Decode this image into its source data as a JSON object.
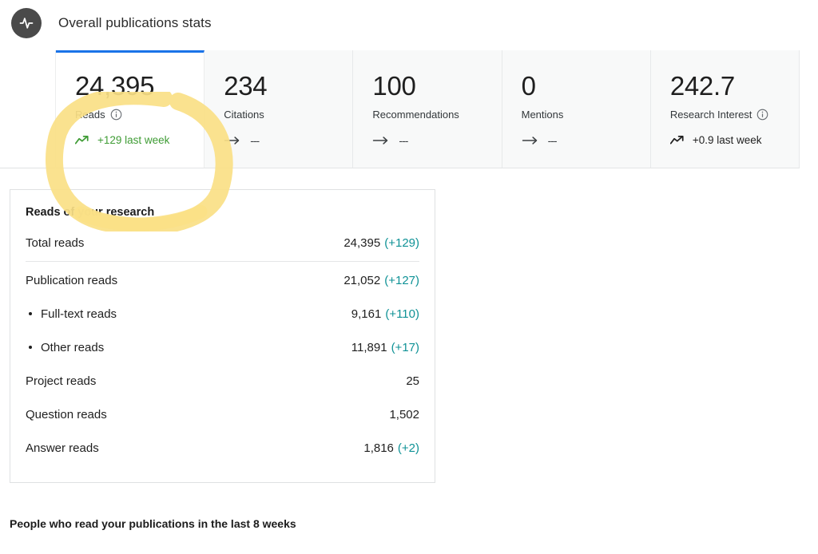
{
  "header": {
    "icon": "activity-pulse-icon",
    "title": "Overall publications stats"
  },
  "stats": {
    "cards": [
      {
        "value": "24,395",
        "label": "Reads",
        "has_info": true,
        "info_icon": "info-circle-icon",
        "trend_icon": "trend-up-icon",
        "trend_text": "+129 last week",
        "trend_state": "up",
        "active": true,
        "highlighted": true
      },
      {
        "value": "234",
        "label": "Citations",
        "has_info": false,
        "trend_icon": "arrow-right-icon",
        "trend_text": "---",
        "trend_state": "flat",
        "active": false,
        "highlighted": false
      },
      {
        "value": "100",
        "label": "Recommendations",
        "has_info": false,
        "trend_icon": "arrow-right-icon",
        "trend_text": "---",
        "trend_state": "flat",
        "active": false,
        "highlighted": false
      },
      {
        "value": "0",
        "label": "Mentions",
        "has_info": false,
        "trend_icon": "arrow-right-icon",
        "trend_text": "---",
        "trend_state": "flat",
        "active": false,
        "highlighted": false
      },
      {
        "value": "242.7",
        "label": "Research Interest",
        "has_info": true,
        "info_icon": "info-circle-icon",
        "trend_icon": "trend-up-icon",
        "trend_text": "+0.9 last week",
        "trend_state": "up-dark",
        "active": false,
        "highlighted": false
      }
    ]
  },
  "reads_card": {
    "title": "Reads of your research",
    "rows": [
      {
        "label": "Total reads",
        "value": "24,395",
        "delta": "(+129)",
        "sub": false,
        "divider_after": true
      },
      {
        "label": "Publication reads",
        "value": "21,052",
        "delta": "(+127)",
        "sub": false,
        "divider_after": false
      },
      {
        "label": "Full-text reads",
        "value": "9,161",
        "delta": "(+110)",
        "sub": true,
        "divider_after": false
      },
      {
        "label": "Other reads",
        "value": "11,891",
        "delta": "(+17)",
        "sub": true,
        "divider_after": false
      },
      {
        "label": "Project reads",
        "value": "25",
        "delta": "",
        "sub": false,
        "divider_after": false
      },
      {
        "label": "Question reads",
        "value": "1,502",
        "delta": "",
        "sub": false,
        "divider_after": false
      },
      {
        "label": "Answer reads",
        "value": "1,816",
        "delta": "(+2)",
        "sub": false,
        "divider_after": false
      }
    ]
  },
  "bottom": {
    "heading": "People who read your publications in the last 8 weeks"
  },
  "colors": {
    "accent_blue": "#1a73e8",
    "trend_green": "#3f9c35",
    "delta_teal": "#0f9296",
    "highlight_yellow": "#fae086",
    "badge_gray": "#4a4a4a"
  }
}
